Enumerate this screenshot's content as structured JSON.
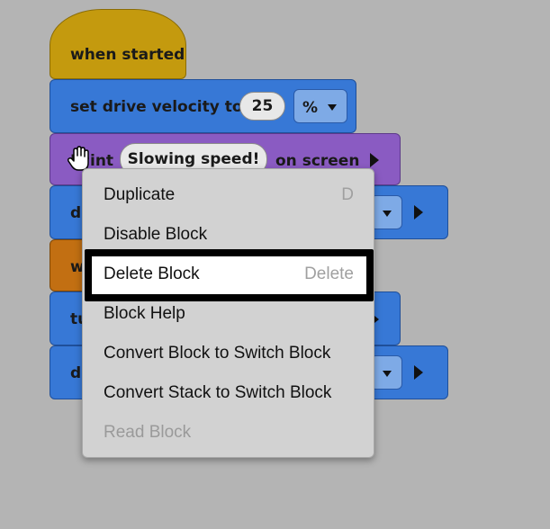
{
  "blocks": {
    "when_started": "when started",
    "set_drive_velocity": {
      "label": "set drive velocity to",
      "value": "25",
      "unit": "%"
    },
    "print": {
      "label_start": "Pr",
      "label_end": "int",
      "text": "Slowing speed!",
      "suffix": "on screen"
    },
    "drive_1": {
      "label": "d"
    },
    "wait": {
      "label": "w"
    },
    "turn": {
      "label": "tu"
    },
    "drive_2": {
      "label": "d"
    }
  },
  "context_menu": {
    "items": [
      {
        "label": "Duplicate",
        "shortcut": "D",
        "enabled": true
      },
      {
        "label": "Disable Block",
        "shortcut": "",
        "enabled": true
      },
      {
        "label": "Delete Block",
        "shortcut": "Delete",
        "enabled": true,
        "highlighted": true
      },
      {
        "label": "Block Help",
        "shortcut": "",
        "enabled": true
      },
      {
        "label": "Convert Block to Switch Block",
        "shortcut": "",
        "enabled": true
      },
      {
        "label": "Convert Stack to Switch Block",
        "shortcut": "",
        "enabled": true
      },
      {
        "label": "Read Block",
        "shortcut": "",
        "enabled": false
      }
    ]
  },
  "colors": {
    "workspace": "#b4b4b4",
    "event_block": "#c49a0e",
    "drive_block": "#3778d6",
    "looks_block": "#8a5bc2",
    "control_block": "#c26f12",
    "menu_background": "#d2d2d2",
    "highlight_border": "#000000"
  },
  "icons": {
    "cursor": "grab-hand-icon",
    "dropdown": "caret-down-icon",
    "run": "play-arrow-icon"
  }
}
